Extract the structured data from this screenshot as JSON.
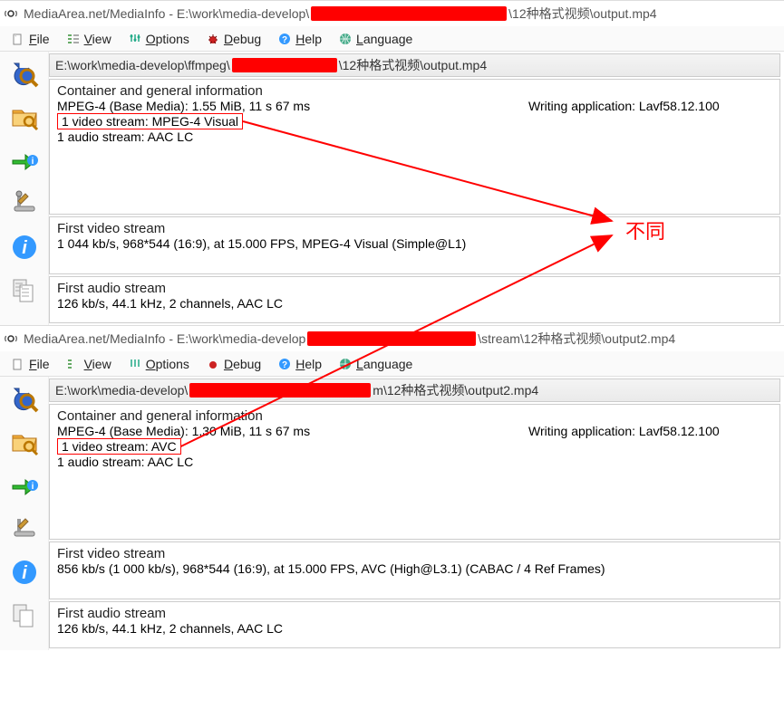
{
  "annotation_label": "不同",
  "windows": [
    {
      "title_prefix": "MediaArea.net/MediaInfo - E:\\work\\media-develop\\",
      "title_suffix": "\\12种格式视频\\output.mp4",
      "redact_w": 216,
      "path_prefix": "E:\\work\\media-develop\\ffmpeg\\",
      "path_suffix": "\\12种格式视频\\output.mp4",
      "path_redact_w": 116,
      "container_title": "Container and general information",
      "container_line": "MPEG-4 (Base Media): 1.55 MiB, 11 s 67 ms",
      "writing_app": "Writing application: Lavf58.12.100",
      "video_stream_line": "1 video stream: MPEG-4 Visual",
      "audio_stream_line": "1 audio stream: AAC LC",
      "first_video_title": "First video stream",
      "first_video_body": "1 044 kb/s, 968*544 (16:9), at 15.000 FPS, MPEG-4 Visual (Simple@L1)",
      "first_audio_title": "First audio stream",
      "first_audio_body": "126 kb/s, 44.1 kHz, 2 channels, AAC LC"
    },
    {
      "title_prefix": "MediaArea.net/MediaInfo - E:\\work\\media-develop",
      "title_suffix": "\\stream\\12种格式视频\\output2.mp4",
      "redact_w": 186,
      "path_prefix": "E:\\work\\media-develop\\",
      "path_suffix": "m\\12种格式视频\\output2.mp4",
      "path_redact_w": 200,
      "container_title": "Container and general information",
      "container_line": "MPEG-4 (Base Media): 1.30 MiB, 11 s 67 ms",
      "writing_app": "Writing application: Lavf58.12.100",
      "video_stream_line": "1 video stream: AVC",
      "audio_stream_line": "1 audio stream: AAC LC",
      "first_video_title": "First video stream",
      "first_video_body": "856 kb/s (1 000 kb/s), 968*544 (16:9), at 15.000 FPS, AVC (High@L3.1) (CABAC / 4 Ref Frames)",
      "first_audio_title": "First audio stream",
      "first_audio_body": "126 kb/s, 44.1 kHz, 2 channels, AAC LC"
    }
  ],
  "menus": {
    "file": "File",
    "view": "View",
    "options": "Options",
    "debug": "Debug",
    "help": "Help",
    "language": "Language"
  },
  "colors": {
    "accent_red": "#ff0000"
  }
}
